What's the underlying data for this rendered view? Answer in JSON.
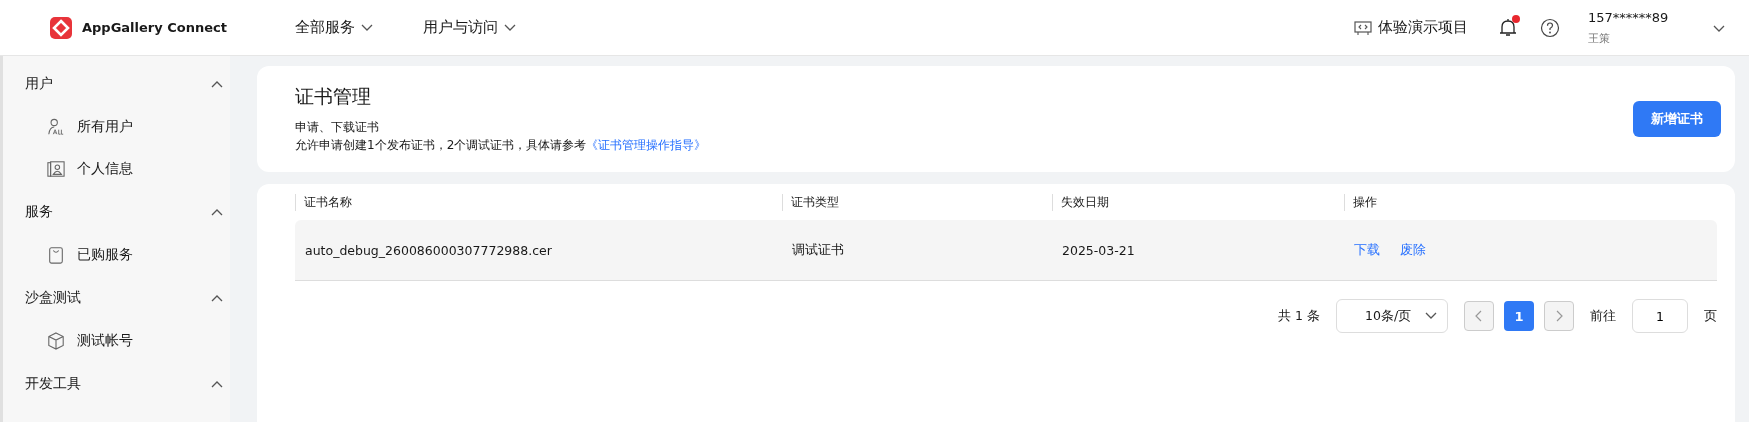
{
  "header": {
    "logo_text": "AppGallery Connect",
    "nav": [
      {
        "label": "全部服务"
      },
      {
        "label": "用户与访问"
      }
    ],
    "demo_project": "体验演示项目",
    "notifications": {
      "unread": true
    },
    "user": {
      "phone": "157******89",
      "name": "王策"
    }
  },
  "sidebar": {
    "groups": [
      {
        "label": "用户",
        "expanded": true,
        "items": [
          {
            "label": "所有用户"
          },
          {
            "label": "个人信息"
          }
        ]
      },
      {
        "label": "服务",
        "expanded": true,
        "items": [
          {
            "label": "已购服务"
          }
        ]
      },
      {
        "label": "沙盒测试",
        "expanded": true,
        "items": [
          {
            "label": "测试帐号"
          }
        ]
      },
      {
        "label": "开发工具",
        "expanded": true
      }
    ]
  },
  "page": {
    "title": "证书管理",
    "subtitle": "申请、下载证书",
    "description": "允许申请创建1个发布证书，2个调试证书，具体请参考",
    "guide_link": "《证书管理操作指导》",
    "add_button": "新增证书"
  },
  "table": {
    "columns": [
      "证书名称",
      "证书类型",
      "失效日期",
      "操作"
    ],
    "rows": [
      {
        "name": "auto_debug_260086000307772988.cer",
        "type": "调试证书",
        "expiry": "2025-03-21",
        "actions": [
          "下载",
          "废除"
        ]
      }
    ]
  },
  "pagination": {
    "total": "共 1 条",
    "page_size": "10条/页",
    "pages": [
      {
        "label": "1",
        "selected": true
      }
    ],
    "goto_label": "前往",
    "goto_value": "1",
    "page_suffix": "页"
  }
}
